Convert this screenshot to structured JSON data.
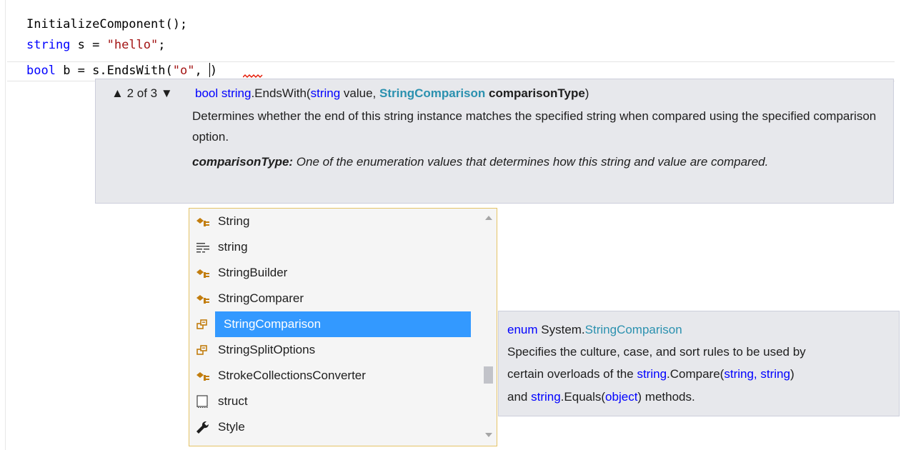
{
  "editor": {
    "line1": {
      "text": "InitializeComponent();"
    },
    "line2": {
      "kw": "string",
      "mid": " s = ",
      "str": "\"hello\"",
      "end": ";"
    },
    "line3": {
      "kw": "bool",
      "mid": " b = s.EndsWith(",
      "str": "\"o\"",
      "end": ", ",
      "close": ")"
    }
  },
  "signature_help": {
    "nav_up": "▲",
    "counter": "2 of 3",
    "nav_down": "▼",
    "ret_type": "bool",
    "owner": "string",
    "method": ".EndsWith(",
    "p1_type": "string",
    "p1_name": " value, ",
    "p2_type": "StringComparison",
    "p2_name": "comparisonType",
    "close": ")",
    "description": "Determines whether the end of this string instance matches the specified string when compared using the specified comparison option.",
    "param_name": "comparisonType:",
    "param_desc": " One of the enumeration values that determines how this string and value are compared."
  },
  "completion_list": {
    "items": [
      {
        "label": "String",
        "icon": "class-icon"
      },
      {
        "label": "string",
        "icon": "keyword-icon"
      },
      {
        "label": "StringBuilder",
        "icon": "class-icon"
      },
      {
        "label": "StringComparer",
        "icon": "class-icon"
      },
      {
        "label": "StringComparison",
        "icon": "enum-icon",
        "selected": true
      },
      {
        "label": "StringSplitOptions",
        "icon": "enum-icon"
      },
      {
        "label": "StrokeCollectionsConverter",
        "icon": "class-icon"
      },
      {
        "label": "struct",
        "icon": "snippet-icon"
      },
      {
        "label": "Style",
        "icon": "wrench-icon"
      }
    ],
    "selected_color": "#3399ff"
  },
  "quick_info": {
    "kw": "enum",
    "ns": " System.",
    "type": "StringComparison",
    "l2": "Specifies the culture, case, and sort rules to be used by",
    "l3_a": "certain overloads of the ",
    "l3_b": "string",
    "l3_c": ".Compare(",
    "l3_d": "string, string",
    "l3_e": ")",
    "l4_a": "and ",
    "l4_b": "string",
    "l4_c": ".Equals(",
    "l4_d": "object",
    "l4_e": ") methods."
  },
  "colors": {
    "keyword": "#0000ff",
    "type": "#2b91af",
    "string_literal": "#a31515",
    "tooltip_bg": "#e7e8ec"
  }
}
